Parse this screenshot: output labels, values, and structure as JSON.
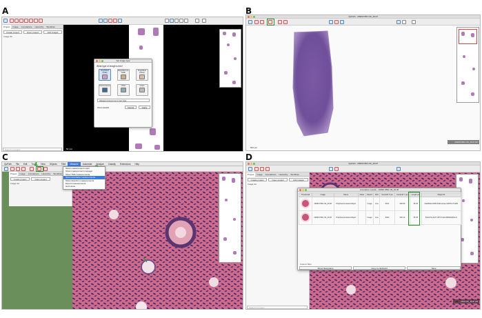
{
  "panels": {
    "a": {
      "label": "A"
    },
    "b": {
      "label": "B"
    },
    "c": {
      "label": "C"
    },
    "d": {
      "label": "D"
    }
  },
  "window_title": "QuPath - 29999 FB0n 09_49.tiff",
  "project_tabs": [
    "Project",
    "Image",
    "Annotations",
    "Hierarchy",
    "Workflow"
  ],
  "project_buttons": {
    "create": "Create project",
    "open": "Open project",
    "add": "Add images"
  },
  "image_list_label": "Image list",
  "search_placeholder": "Search in project",
  "scale_bars": {
    "a": "50 mm",
    "b": "500 µm",
    "d": "100 µm"
  },
  "overview_text": {
    "b": "29999 FB0n 09_49.tif 0/0",
    "d": "FB0n 09_49.tif 0/0"
  },
  "image_type_dialog": {
    "title": "Set image type",
    "question": "What type of image is this?",
    "types": [
      {
        "label": "Brightfield (H&E)",
        "selected": true
      },
      {
        "label": "Brightfield (H-DAB)",
        "selected": false
      },
      {
        "label": "Brightfield (Other)",
        "selected": false
      },
      {
        "label": "Fluorescence",
        "selected": false
      },
      {
        "label": "Other",
        "selected": false
      },
      {
        "label": "Unset",
        "selected": false
      }
    ],
    "dropdown": "Always prompt me to set type",
    "show_details": "Show details",
    "cancel": "Cancel",
    "apply": "Apply"
  },
  "mac_menubar": [
    "QuPath",
    "File",
    "Edit",
    "Tools",
    "View",
    "Objects",
    "TMA",
    "Measure",
    "Automate",
    "Analyze",
    "Classify",
    "Extensions",
    "Help"
  ],
  "active_menu": "Measure",
  "measure_menu": [
    {
      "label": "Show measurement maps",
      "active": false
    },
    {
      "label": "Show measurement manager",
      "active": false
    },
    {
      "label": "Show TMA measurements",
      "active": false
    },
    {
      "label": "Show annotation measurements",
      "active": true
    },
    {
      "label": "Show detection measurements",
      "active": false
    },
    {
      "label": "Export measurements",
      "active": false
    },
    {
      "label": "Grid views",
      "active": false
    }
  ],
  "step_markers": {
    "one": "1",
    "three": "3"
  },
  "results_window": {
    "title": "Annotation results - 29999 FB0n 09_49.tiff",
    "columns": [
      "Thumbnail",
      "Image",
      "Name",
      "Class",
      "Parent",
      "ROI",
      "Centroid X µm",
      "Centroid Y µm",
      "Length µm",
      "Object ID"
    ],
    "rows": [
      [
        "",
        "29999 FB0n 09_49.tiff",
        "PolylineAnnotationObject",
        "",
        "Image",
        "Line",
        "6161",
        "395.95",
        "36.36",
        "6ad0fd2e-8c89-4a9d-a1aa-4c4871c71a90"
      ],
      [
        "",
        "29999 FB0n 09_49.tiff",
        "PolylineAnnotationObject",
        "",
        "Image",
        "Line",
        "6024",
        "339.13",
        "36.36",
        "f5dc27fa-3c07-4b7f-b1e9-380f4b9b6cc2"
      ]
    ],
    "footer_label": "Column filter",
    "buttons": [
      "Show histograms",
      "Copy to clipboard",
      "Save"
    ]
  },
  "colors": {
    "highlight": "#2a8c2a",
    "menu_active": "#3b7be0",
    "tissue": "#b07ab8"
  }
}
